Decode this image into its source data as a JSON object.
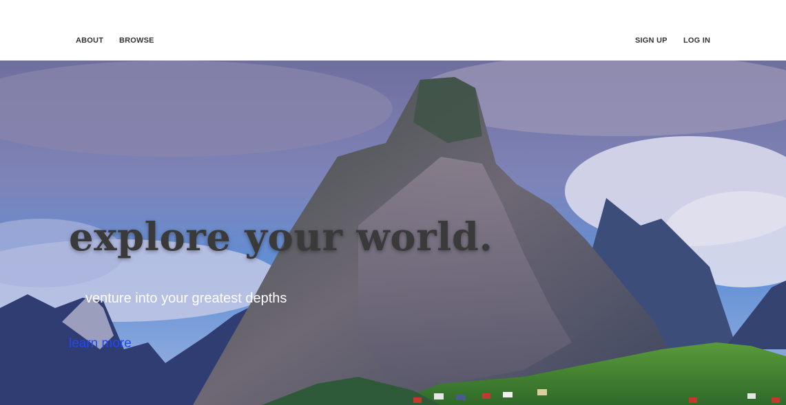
{
  "nav": {
    "left": [
      "ABOUT",
      "BROWSE"
    ],
    "right": [
      "SIGN UP",
      "LOG IN"
    ]
  },
  "hero": {
    "headline": "explore your world.",
    "tagline": "venture into your greatest depths",
    "cta": "learn more",
    "background_image": "mountain-landscape"
  },
  "colors": {
    "nav_text": "#333333",
    "headline": "#3a3a3a",
    "tagline": "#ffffff",
    "cta": "#1f49ff"
  }
}
